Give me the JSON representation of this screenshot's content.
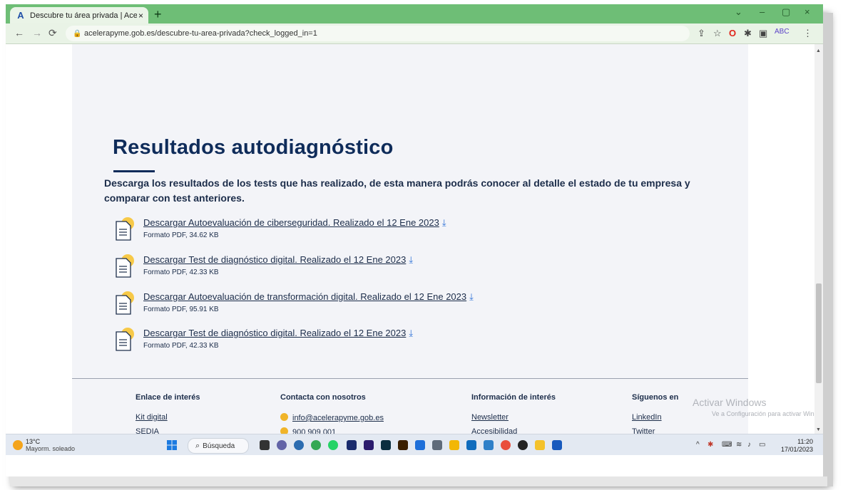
{
  "browser": {
    "tab_title": "Descubre tu área privada | Acele",
    "tab_close": "×",
    "new_tab": "+",
    "url": "acelerapyme.gob.es/descubre-tu-area-privada?check_logged_in=1",
    "window_minimize": "–",
    "window_restore": "▢",
    "window_close": "×",
    "window_dropdown": "⌄"
  },
  "main": {
    "heading": "Resultados autodiagnóstico",
    "intro": "Descarga los resultados de los tests que has realizado, de esta manera podrás conocer al detalle el estado de tu empresa y comparar con test anteriores.",
    "downloads": [
      {
        "label": "Descargar Autoevaluación de ciberseguridad. Realizado el 12 Ene 2023",
        "meta": "Formato PDF, 34.62 KB"
      },
      {
        "label": "Descargar Test de diagnóstico digital. Realizado el 12 Ene 2023",
        "meta": "Formato PDF, 42.33 KB"
      },
      {
        "label": "Descargar Autoevaluación de transformación digital. Realizado el 12 Ene 2023",
        "meta": "Formato PDF, 95.91 KB"
      },
      {
        "label": "Descargar Test de diagnóstico digital. Realizado el 12 Ene 2023",
        "meta": "Formato PDF, 42.33 KB"
      }
    ]
  },
  "footer": {
    "col1": {
      "title": "Enlace de interés",
      "links": [
        "Kit digital",
        "SEDIA"
      ]
    },
    "col2": {
      "title": "Contacta con nosotros",
      "email": "info@acelerapyme.gob.es",
      "phone": "900 909 001"
    },
    "col3": {
      "title": "Información de interés",
      "links": [
        "Newsletter",
        "Accesibilidad"
      ]
    },
    "col4": {
      "title": "Síguenos en",
      "links": [
        "LinkedIn",
        "Twitter"
      ]
    }
  },
  "watermark": {
    "line1": "Activar Windows",
    "line2": "Ve a Configuración para activar Windows."
  },
  "taskbar": {
    "temperature": "13°C",
    "weather": "Mayorm. soleado",
    "search_label": "Búsqueda",
    "time": "11:20",
    "date": "17/01/2023"
  }
}
